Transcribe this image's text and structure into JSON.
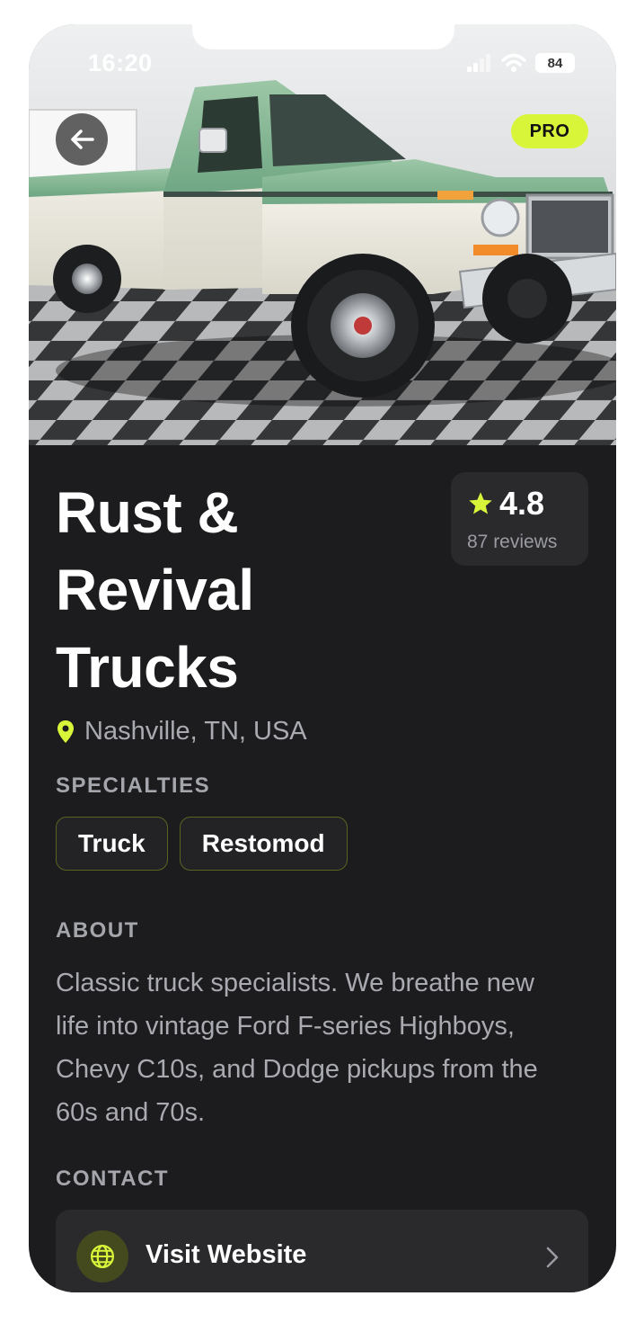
{
  "status_bar": {
    "time": "16:20",
    "battery": "84"
  },
  "hero": {
    "badge": "PRO",
    "image_subject": "green and white vintage pickup truck on checkered floor"
  },
  "shop": {
    "name": "Rust & Revival Trucks",
    "location": "Nashville, TN, USA",
    "rating": "4.8",
    "reviews": "87 reviews"
  },
  "specialties": {
    "label": "SPECIALTIES",
    "items": [
      "Truck",
      "Restomod"
    ]
  },
  "about": {
    "label": "ABOUT",
    "text": "Classic truck specialists. We breathe new life into vintage Ford F-series Highboys, Chevy C10s, and Dodge pickups from the 60s and 70s."
  },
  "contact": {
    "label": "CONTACT",
    "website_label": "Visit Website"
  },
  "colors": {
    "accent": "#D9F53A",
    "background": "#1C1C1F",
    "card": "#2A2A2D"
  },
  "icons": {
    "back": "arrow-left-icon",
    "location": "map-pin-icon",
    "star": "star-icon",
    "website": "globe-icon",
    "chevron": "chevron-right-icon"
  }
}
